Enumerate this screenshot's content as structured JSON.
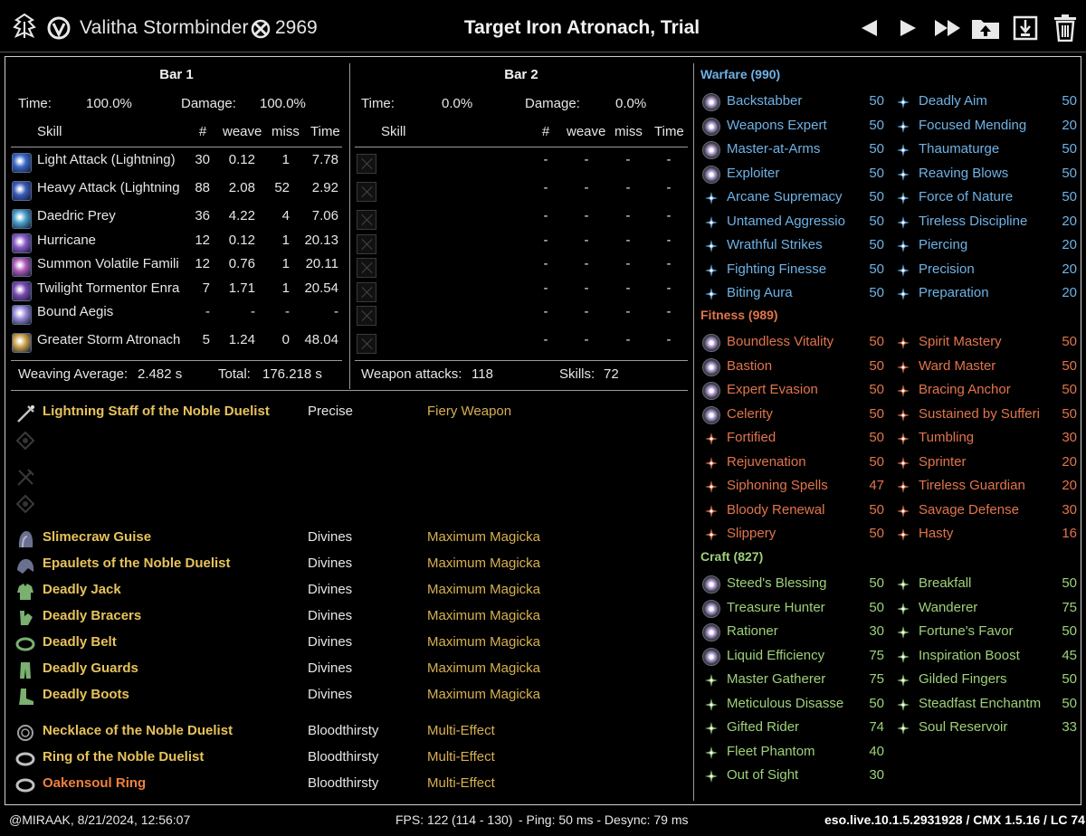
{
  "header": {
    "character_name": "Valitha Stormbinder",
    "champion_points": "2969",
    "title": "Target Iron Atronach, Trial",
    "buttons": [
      "previous",
      "next",
      "fast-forward",
      "upload",
      "save",
      "delete"
    ]
  },
  "bar1": {
    "title": "Bar 1",
    "time_label": "Time:",
    "time_value": "100.0%",
    "damage_label": "Damage:",
    "damage_value": "100.0%",
    "columns": [
      "Skill",
      "#",
      "weave",
      "miss",
      "Time"
    ],
    "rows": [
      {
        "skill": "Light Attack (Lightning)",
        "count": "30",
        "weave": "0.12",
        "miss": "1",
        "time": "7.78",
        "icon_color": "#3a68c8"
      },
      {
        "skill": "Heavy Attack (Lightning",
        "count": "88",
        "weave": "2.08",
        "miss": "52",
        "time": "2.92",
        "icon_color": "#3a5cb8"
      },
      {
        "skill": "Daedric Prey",
        "count": "36",
        "weave": "4.22",
        "miss": "4",
        "time": "7.06",
        "icon_color": "#4aa0c8"
      },
      {
        "skill": "Hurricane",
        "count": "12",
        "weave": "0.12",
        "miss": "1",
        "time": "20.13",
        "icon_color": "#8a5ac8"
      },
      {
        "skill": "Summon Volatile Famili",
        "count": "12",
        "weave": "0.76",
        "miss": "1",
        "time": "20.11",
        "icon_color": "#b05ab8"
      },
      {
        "skill": "Twilight Tormentor Enra",
        "count": "7",
        "weave": "1.71",
        "miss": "1",
        "time": "20.54",
        "icon_color": "#7a4ab0"
      },
      {
        "skill": "Bound Aegis",
        "count": "-",
        "weave": "-",
        "miss": "-",
        "time": "-",
        "icon_color": "#9a8ad8"
      },
      {
        "skill": "Greater Storm Atronach",
        "count": "5",
        "weave": "1.24",
        "miss": "0",
        "time": "48.04",
        "icon_color": "#c8a048"
      }
    ],
    "weaving_label": "Weaving Average:",
    "weaving_value": "2.482 s",
    "total_label": "Total:",
    "total_value": "176.218 s"
  },
  "bar2": {
    "title": "Bar 2",
    "time_label": "Time:",
    "time_value": "0.0%",
    "damage_label": "Damage:",
    "damage_value": "0.0%",
    "columns": [
      "Skill",
      "#",
      "weave",
      "miss",
      "Time"
    ],
    "rows": [
      {
        "count": "-",
        "weave": "-",
        "miss": "-",
        "time": "-"
      },
      {
        "count": "-",
        "weave": "-",
        "miss": "-",
        "time": "-"
      },
      {
        "count": "-",
        "weave": "-",
        "miss": "-",
        "time": "-"
      },
      {
        "count": "-",
        "weave": "-",
        "miss": "-",
        "time": "-"
      },
      {
        "count": "-",
        "weave": "-",
        "miss": "-",
        "time": "-"
      },
      {
        "count": "-",
        "weave": "-",
        "miss": "-",
        "time": "-"
      },
      {
        "count": "-",
        "weave": "-",
        "miss": "-",
        "time": "-"
      },
      {
        "count": "-",
        "weave": "-",
        "miss": "-",
        "time": "-"
      }
    ],
    "weapon_attacks_label": "Weapon attacks:",
    "weapon_attacks_value": "118",
    "skills_label": "Skills:",
    "skills_value": "72"
  },
  "gear": [
    {
      "name": "Lightning Staff of the Noble Duelist",
      "trait": "Precise",
      "enchant": "Fiery Weapon",
      "icon": "staff-icon",
      "quality": "legendary"
    },
    {
      "name": "",
      "trait": "",
      "enchant": "",
      "icon": "empty-offhand-icon",
      "quality": "none"
    },
    {
      "name": "",
      "trait": "",
      "enchant": "",
      "icon": "empty-backbar-weapon-icon",
      "quality": "none"
    },
    {
      "name": "",
      "trait": "",
      "enchant": "",
      "icon": "empty-backbar-offhand-icon",
      "quality": "none"
    },
    {
      "name": "Slimecraw Guise",
      "trait": "Divines",
      "enchant": "Maximum Magicka",
      "icon": "head-icon",
      "quality": "legendary"
    },
    {
      "name": "Epaulets of the Noble Duelist",
      "trait": "Divines",
      "enchant": "Maximum Magicka",
      "icon": "shoulders-icon",
      "quality": "legendary"
    },
    {
      "name": "Deadly Jack",
      "trait": "Divines",
      "enchant": "Maximum Magicka",
      "icon": "chest-icon",
      "quality": "legendary"
    },
    {
      "name": "Deadly Bracers",
      "trait": "Divines",
      "enchant": "Maximum Magicka",
      "icon": "hands-icon",
      "quality": "legendary"
    },
    {
      "name": "Deadly Belt",
      "trait": "Divines",
      "enchant": "Maximum Magicka",
      "icon": "belt-icon",
      "quality": "legendary"
    },
    {
      "name": "Deadly Guards",
      "trait": "Divines",
      "enchant": "Maximum Magicka",
      "icon": "legs-icon",
      "quality": "legendary"
    },
    {
      "name": "Deadly Boots",
      "trait": "Divines",
      "enchant": "Maximum Magicka",
      "icon": "feet-icon",
      "quality": "legendary"
    },
    {
      "name": "Necklace of the Noble Duelist",
      "trait": "Bloodthirsty",
      "enchant": "Multi-Effect",
      "icon": "necklace-icon",
      "quality": "legendary"
    },
    {
      "name": "Ring of the Noble Duelist",
      "trait": "Bloodthirsty",
      "enchant": "Multi-Effect",
      "icon": "ring-icon",
      "quality": "legendary"
    },
    {
      "name": "Oakensoul Ring",
      "trait": "Bloodthirsty",
      "enchant": "Multi-Effect",
      "icon": "ring-icon",
      "quality": "mythic"
    }
  ],
  "cp": {
    "warfare": {
      "header": "Warfare (990)",
      "color": "#6fb2e6",
      "left": [
        {
          "name": "Backstabber",
          "value": "50",
          "slotted": true
        },
        {
          "name": "Weapons Expert",
          "value": "50",
          "slotted": true
        },
        {
          "name": "Master-at-Arms",
          "value": "50",
          "slotted": true
        },
        {
          "name": "Exploiter",
          "value": "50",
          "slotted": true
        },
        {
          "name": "Arcane Supremacy",
          "value": "50",
          "slotted": false
        },
        {
          "name": "Untamed Aggressio",
          "value": "50",
          "slotted": false
        },
        {
          "name": "Wrathful Strikes",
          "value": "50",
          "slotted": false
        },
        {
          "name": "Fighting Finesse",
          "value": "50",
          "slotted": false
        },
        {
          "name": "Biting Aura",
          "value": "50",
          "slotted": false
        }
      ],
      "right": [
        {
          "name": "Deadly Aim",
          "value": "50"
        },
        {
          "name": "Focused Mending",
          "value": "20"
        },
        {
          "name": "Thaumaturge",
          "value": "50"
        },
        {
          "name": "Reaving Blows",
          "value": "50"
        },
        {
          "name": "Force of Nature",
          "value": "50"
        },
        {
          "name": "Tireless Discipline",
          "value": "20"
        },
        {
          "name": "Piercing",
          "value": "20"
        },
        {
          "name": "Precision",
          "value": "20"
        },
        {
          "name": "Preparation",
          "value": "20"
        }
      ]
    },
    "fitness": {
      "header": "Fitness (989)",
      "color": "#e2744c",
      "left": [
        {
          "name": "Boundless Vitality",
          "value": "50",
          "slotted": true
        },
        {
          "name": "Bastion",
          "value": "50",
          "slotted": true
        },
        {
          "name": "Expert Evasion",
          "value": "50",
          "slotted": true
        },
        {
          "name": "Celerity",
          "value": "50",
          "slotted": true
        },
        {
          "name": "Fortified",
          "value": "50",
          "slotted": false
        },
        {
          "name": "Rejuvenation",
          "value": "50",
          "slotted": false
        },
        {
          "name": "Siphoning Spells",
          "value": "47",
          "slotted": false
        },
        {
          "name": "Bloody Renewal",
          "value": "50",
          "slotted": false
        },
        {
          "name": "Slippery",
          "value": "50",
          "slotted": false
        }
      ],
      "right": [
        {
          "name": "Spirit Mastery",
          "value": "50"
        },
        {
          "name": "Ward Master",
          "value": "50"
        },
        {
          "name": "Bracing Anchor",
          "value": "50"
        },
        {
          "name": "Sustained by Sufferi",
          "value": "50"
        },
        {
          "name": "Tumbling",
          "value": "30"
        },
        {
          "name": "Sprinter",
          "value": "20"
        },
        {
          "name": "Tireless Guardian",
          "value": "20"
        },
        {
          "name": "Savage Defense",
          "value": "30"
        },
        {
          "name": "Hasty",
          "value": "16"
        }
      ]
    },
    "craft": {
      "header": "Craft (827)",
      "color": "#9ed17a",
      "left": [
        {
          "name": "Steed's Blessing",
          "value": "50",
          "slotted": true
        },
        {
          "name": "Treasure Hunter",
          "value": "50",
          "slotted": true
        },
        {
          "name": "Rationer",
          "value": "30",
          "slotted": true
        },
        {
          "name": "Liquid Efficiency",
          "value": "75",
          "slotted": true
        },
        {
          "name": "Master Gatherer",
          "value": "75",
          "slotted": false
        },
        {
          "name": "Meticulous Disasse",
          "value": "50",
          "slotted": false
        },
        {
          "name": "Gifted Rider",
          "value": "74",
          "slotted": false
        },
        {
          "name": "Fleet Phantom",
          "value": "40",
          "slotted": false
        },
        {
          "name": "Out of Sight",
          "value": "30",
          "slotted": false
        }
      ],
      "right": [
        {
          "name": "Breakfall",
          "value": "50"
        },
        {
          "name": "Wanderer",
          "value": "75"
        },
        {
          "name": "Fortune's Favor",
          "value": "50"
        },
        {
          "name": "Inspiration Boost",
          "value": "45"
        },
        {
          "name": "Gilded Fingers",
          "value": "50"
        },
        {
          "name": "Steadfast Enchantm",
          "value": "50"
        },
        {
          "name": "Soul Reservoir",
          "value": "33"
        }
      ]
    }
  },
  "footer": {
    "author": "@MIRAAK, 8/21/2024, 12:56:07",
    "fps_label": "FPS: 122",
    "fps_range": "(114 - 130)",
    "ping": "- Ping: 50 ms - Desync: 79 ms",
    "version": "eso.live.10.1.5.2931928 / CMX 1.5.16 / LC 74"
  }
}
